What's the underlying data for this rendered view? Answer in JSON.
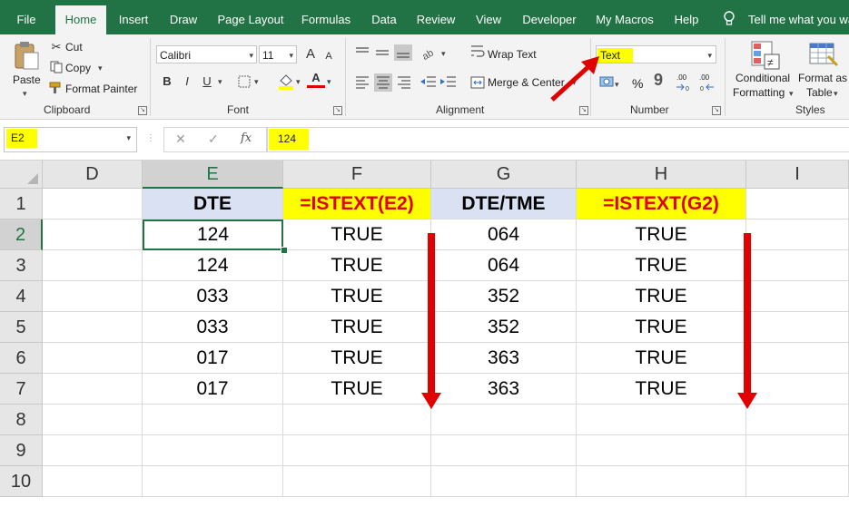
{
  "ribbon_tabs": [
    "File",
    "Home",
    "Insert",
    "Draw",
    "Page Layout",
    "Formulas",
    "Data",
    "Review",
    "View",
    "Developer",
    "My Macros",
    "Help"
  ],
  "tell_me": "Tell me what you war",
  "clipboard": {
    "paste": "Paste",
    "cut": "Cut",
    "copy": "Copy",
    "format_painter": "Format Painter",
    "label": "Clipboard"
  },
  "font": {
    "name": "Calibri",
    "size": "11",
    "bold": "B",
    "italic": "I",
    "underline": "U",
    "label": "Font",
    "grow": "A",
    "shrink": "A",
    "color_letter": "A"
  },
  "alignment": {
    "wrap_text": "Wrap Text",
    "merge_center": "Merge & Center",
    "label": "Alignment"
  },
  "number": {
    "format": "Text",
    "percent": "%",
    "comma": "9",
    "label": "Number",
    "inc_decimal": ".00",
    "dec_decimal": ".00"
  },
  "styles": {
    "conditional_1": "Conditional",
    "conditional_2": "Formatting",
    "format_as_1": "Format as",
    "format_as_2": "Table",
    "label": "Styles"
  },
  "formula_bar": {
    "name_box": "E2",
    "value": "124",
    "cancel": "✕",
    "enter": "✓",
    "fx": "fx"
  },
  "colors": {
    "excel_green": "#217346",
    "highlight": "#ffff00",
    "header_blue": "#d9e1f2",
    "arrow_red": "#e00000"
  },
  "grid": {
    "columns": [
      "D",
      "E",
      "F",
      "G",
      "H",
      "I"
    ],
    "rows": [
      "1",
      "2",
      "3",
      "4",
      "5",
      "6",
      "7",
      "8",
      "9",
      "10"
    ],
    "headers": {
      "E": "DTE",
      "F": "=ISTEXT(E2)",
      "G": "DTE/TME",
      "H": "=ISTEXT(G2)"
    },
    "E": [
      "124",
      "124",
      "033",
      "033",
      "017",
      "017"
    ],
    "F": [
      "TRUE",
      "TRUE",
      "TRUE",
      "TRUE",
      "TRUE",
      "TRUE"
    ],
    "G": [
      "064",
      "064",
      "352",
      "352",
      "363",
      "363"
    ],
    "H": [
      "TRUE",
      "TRUE",
      "TRUE",
      "TRUE",
      "TRUE",
      "TRUE"
    ]
  }
}
